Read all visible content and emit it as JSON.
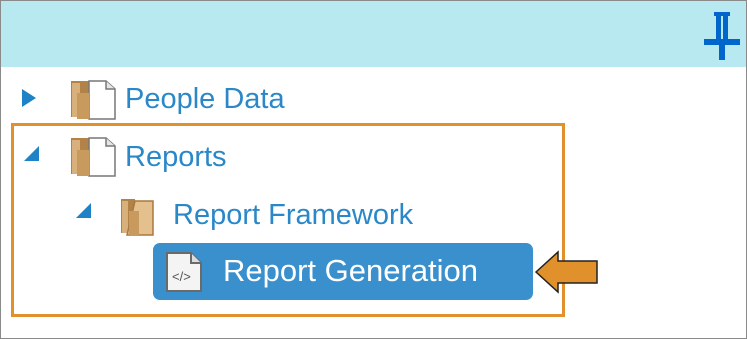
{
  "tree": {
    "items": [
      {
        "label": "People Data",
        "state": "collapsed",
        "icon": "folder-icon"
      },
      {
        "label": "Reports",
        "state": "expanded",
        "icon": "folder-icon"
      },
      {
        "label": "Report Framework",
        "state": "expanded",
        "icon": "folder-icon"
      },
      {
        "label": "Report Generation",
        "state": "selected",
        "icon": "code-file-icon"
      }
    ]
  },
  "colors": {
    "header_bg": "#b8e8f0",
    "link_blue": "#2a88c8",
    "selected_bg": "#3a90cc",
    "highlight_orange": "#e0912b",
    "pin_blue": "#0066cc"
  }
}
